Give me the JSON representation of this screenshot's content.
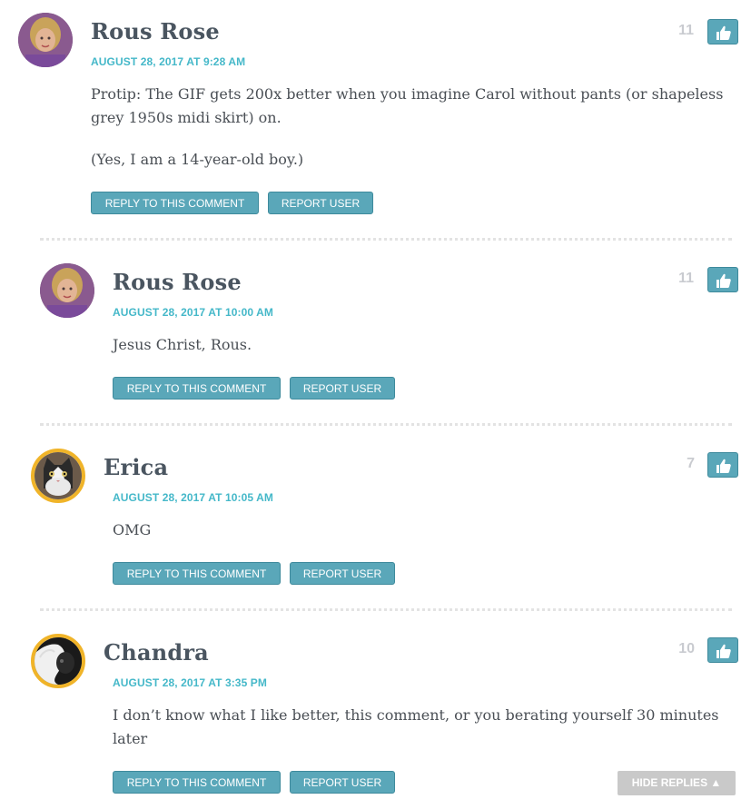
{
  "comments": [
    {
      "author": "Rous Rose",
      "date": "AUGUST 28, 2017 AT 9:28 AM",
      "paragraphs": [
        "Protip: The GIF gets 200x better when you imagine Carol without pants (or shapeless grey 1950s midi skirt) on.",
        "(Yes, I am a 14-year-old boy.)"
      ],
      "votes": "11",
      "reply_label": "REPLY TO THIS COMMENT",
      "report_label": "REPORT USER"
    },
    {
      "author": "Rous Rose",
      "date": "AUGUST 28, 2017 AT 10:00 AM",
      "paragraphs": [
        "Jesus Christ, Rous."
      ],
      "votes": "11",
      "reply_label": "REPLY TO THIS COMMENT",
      "report_label": "REPORT USER"
    },
    {
      "author": "Erica",
      "date": "AUGUST 28, 2017 AT 10:05 AM",
      "paragraphs": [
        "OMG"
      ],
      "votes": "7",
      "reply_label": "REPLY TO THIS COMMENT",
      "report_label": "REPORT USER"
    },
    {
      "author": "Chandra",
      "date": "AUGUST 28, 2017 AT 3:35 PM",
      "paragraphs": [
        "I don’t know what I like better, this comment, or you berating yourself 30 minutes later"
      ],
      "votes": "10",
      "reply_label": "REPLY TO THIS COMMENT",
      "report_label": "REPORT USER"
    }
  ],
  "hide_replies_label": "HIDE REPLIES ▲",
  "colors": {
    "accent": "#5aa7b9",
    "date": "#45b8c9",
    "author": "#4a5560",
    "vote_count": "#c9cbd0"
  },
  "icons": {
    "like": "thumbs-up-icon"
  }
}
